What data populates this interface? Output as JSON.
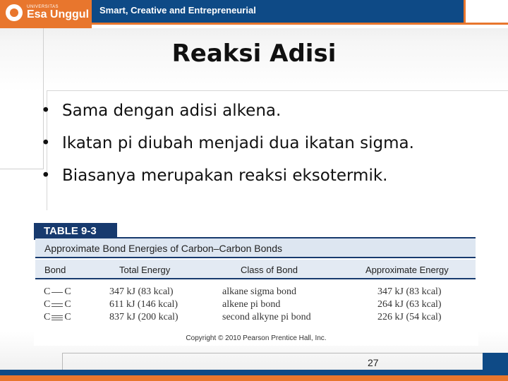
{
  "header": {
    "logo_small": "UNIVERSITAS",
    "logo_name": "Esa Unggul",
    "tagline": "Smart, Creative and Entrepreneurial"
  },
  "slide": {
    "title": "Reaksi Adisi",
    "bullets": [
      "Sama dengan adisi alkena.",
      "Ikatan pi diubah menjadi dua ikatan sigma.",
      "Biasanya merupakan reaksi eksotermik."
    ],
    "bullet_char": "•"
  },
  "table": {
    "tab": "TABLE 9-3",
    "caption": "Approximate Bond Energies of Carbon–Carbon Bonds",
    "columns": [
      "Bond",
      "Total Energy",
      "Class of Bond",
      "Approximate Energy"
    ],
    "rows": [
      {
        "atom1": "C",
        "atom2": "C",
        "order": 1,
        "total": "347 kJ (83 kcal)",
        "class": "alkane sigma bond",
        "approx": "347 kJ (83 kcal)"
      },
      {
        "atom1": "C",
        "atom2": "C",
        "order": 2,
        "total": "611 kJ (146 kcal)",
        "class": "alkene pi bond",
        "approx": "264 kJ (63 kcal)"
      },
      {
        "atom1": "C",
        "atom2": "C",
        "order": 3,
        "total": "837 kJ (200 kcal)",
        "class": "second alkyne pi bond",
        "approx": "226 kJ (54 kcal)"
      }
    ],
    "copyright": "Copyright © 2010 Pearson Prentice Hall, Inc."
  },
  "footer": {
    "page_number": "27"
  },
  "colors": {
    "brand_orange": "#e8762d",
    "brand_blue": "#0e4a86",
    "table_navy": "#173a6e"
  }
}
